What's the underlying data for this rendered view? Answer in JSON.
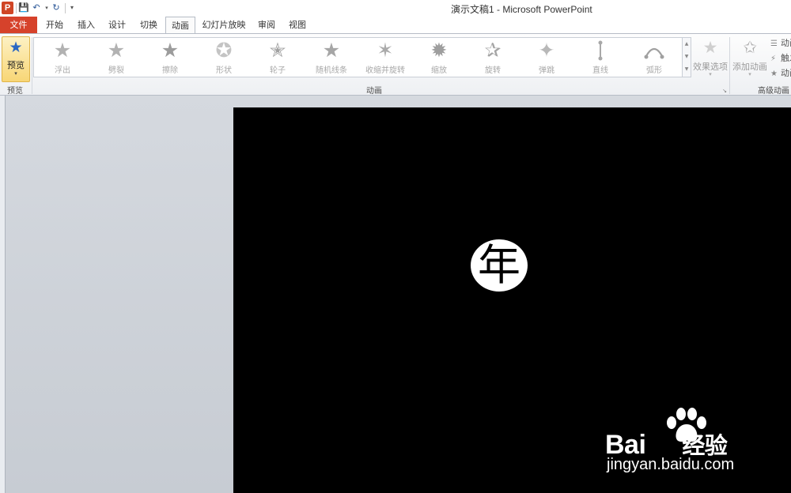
{
  "window": {
    "title": "演示文稿1 - Microsoft PowerPoint",
    "app_logo_letter": "P"
  },
  "quick_access": {
    "save_icon": "save-icon",
    "undo_icon": "undo-icon",
    "redo_icon": "redo-icon",
    "customize_icon": "customize-dropdown-icon"
  },
  "tabs": [
    {
      "label": "文件"
    },
    {
      "label": "开始"
    },
    {
      "label": "插入"
    },
    {
      "label": "设计"
    },
    {
      "label": "切换"
    },
    {
      "label": "动画"
    },
    {
      "label": "幻灯片放映"
    },
    {
      "label": "审阅"
    },
    {
      "label": "视图"
    }
  ],
  "active_tab": "动画",
  "ribbon": {
    "preview": {
      "button_label": "预览",
      "group_label": "预览"
    },
    "animation_group_label": "动画",
    "animations": [
      {
        "label": "浮出",
        "icon": "star-float-icon"
      },
      {
        "label": "劈裂",
        "icon": "star-split-icon"
      },
      {
        "label": "擦除",
        "icon": "star-wipe-icon"
      },
      {
        "label": "形状",
        "icon": "star-shape-icon"
      },
      {
        "label": "轮子",
        "icon": "star-wheel-icon"
      },
      {
        "label": "随机线条",
        "icon": "star-random-bars-icon"
      },
      {
        "label": "收缩并旋转",
        "icon": "star-shrink-turn-icon"
      },
      {
        "label": "缩放",
        "icon": "star-zoom-icon"
      },
      {
        "label": "旋转",
        "icon": "star-swivel-icon"
      },
      {
        "label": "弹跳",
        "icon": "star-bounce-icon"
      },
      {
        "label": "直线",
        "icon": "line-path-icon"
      },
      {
        "label": "弧形",
        "icon": "arc-path-icon"
      }
    ],
    "effect_options_label": "效果选项",
    "add_animation_label": "添加动画",
    "advanced_group_label": "高级动画",
    "advanced_small": [
      {
        "label": "动画窗格",
        "icon": "animation-pane-icon"
      },
      {
        "label": "触发",
        "icon": "trigger-icon"
      },
      {
        "label": "动画刷",
        "icon": "animation-painter-icon"
      }
    ]
  },
  "slide": {
    "background": "#000000",
    "animated_char": "年"
  },
  "watermark": {
    "brand": "Bai",
    "brand_suffix": "经验",
    "url": "jingyan.baidu.com"
  },
  "colors": {
    "file_tab": "#d6422b",
    "preview_highlight": "#f8d676",
    "slide_bg": "#000000"
  }
}
